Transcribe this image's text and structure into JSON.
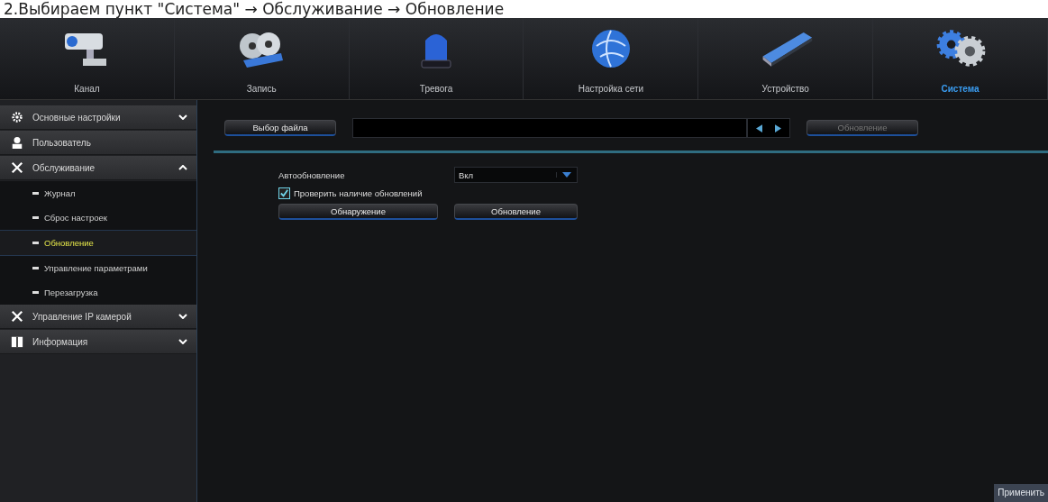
{
  "caption": "2.Выбираем пункт \"Система\" → Обслуживание → Обновление",
  "tabs": [
    {
      "label": "Канал",
      "kind": "camera",
      "selected": false
    },
    {
      "label": "Запись",
      "kind": "film",
      "selected": false
    },
    {
      "label": "Тревога",
      "kind": "siren",
      "selected": false
    },
    {
      "label": "Настройка сети",
      "kind": "globe",
      "selected": false
    },
    {
      "label": "Устройство",
      "kind": "drive",
      "selected": false
    },
    {
      "label": "Система",
      "kind": "gears",
      "selected": true
    }
  ],
  "sidebar": {
    "items": [
      {
        "label": "Основные настройки",
        "kind": "gear",
        "expanded": false
      },
      {
        "label": "Пользователь",
        "kind": "user"
      },
      {
        "label": "Обслуживание",
        "kind": "tools",
        "expanded": true,
        "children": [
          {
            "label": "Журнал",
            "selected": false
          },
          {
            "label": "Сброс настроек",
            "selected": false
          },
          {
            "label": "Обновление",
            "selected": true
          },
          {
            "label": "Управление параметрами",
            "selected": false
          },
          {
            "label": "Перезагрузка",
            "selected": false
          }
        ]
      },
      {
        "label": "Управление IP камерой",
        "kind": "tools",
        "expanded": false
      },
      {
        "label": "Информация",
        "kind": "book",
        "expanded": false
      }
    ]
  },
  "file_row": {
    "choose_button": "Выбор файла",
    "update_button": {
      "label": "Обновление",
      "disabled": true
    }
  },
  "auto_update": {
    "label": "Автообновление",
    "value": "Вкл"
  },
  "check_updates": {
    "label": "Проверить наличие обновлений",
    "checked": true
  },
  "action_buttons": [
    {
      "label": "Обнаружение",
      "disabled": false
    },
    {
      "label": "Обновление",
      "disabled": false
    }
  ],
  "apply_button": "Применить"
}
